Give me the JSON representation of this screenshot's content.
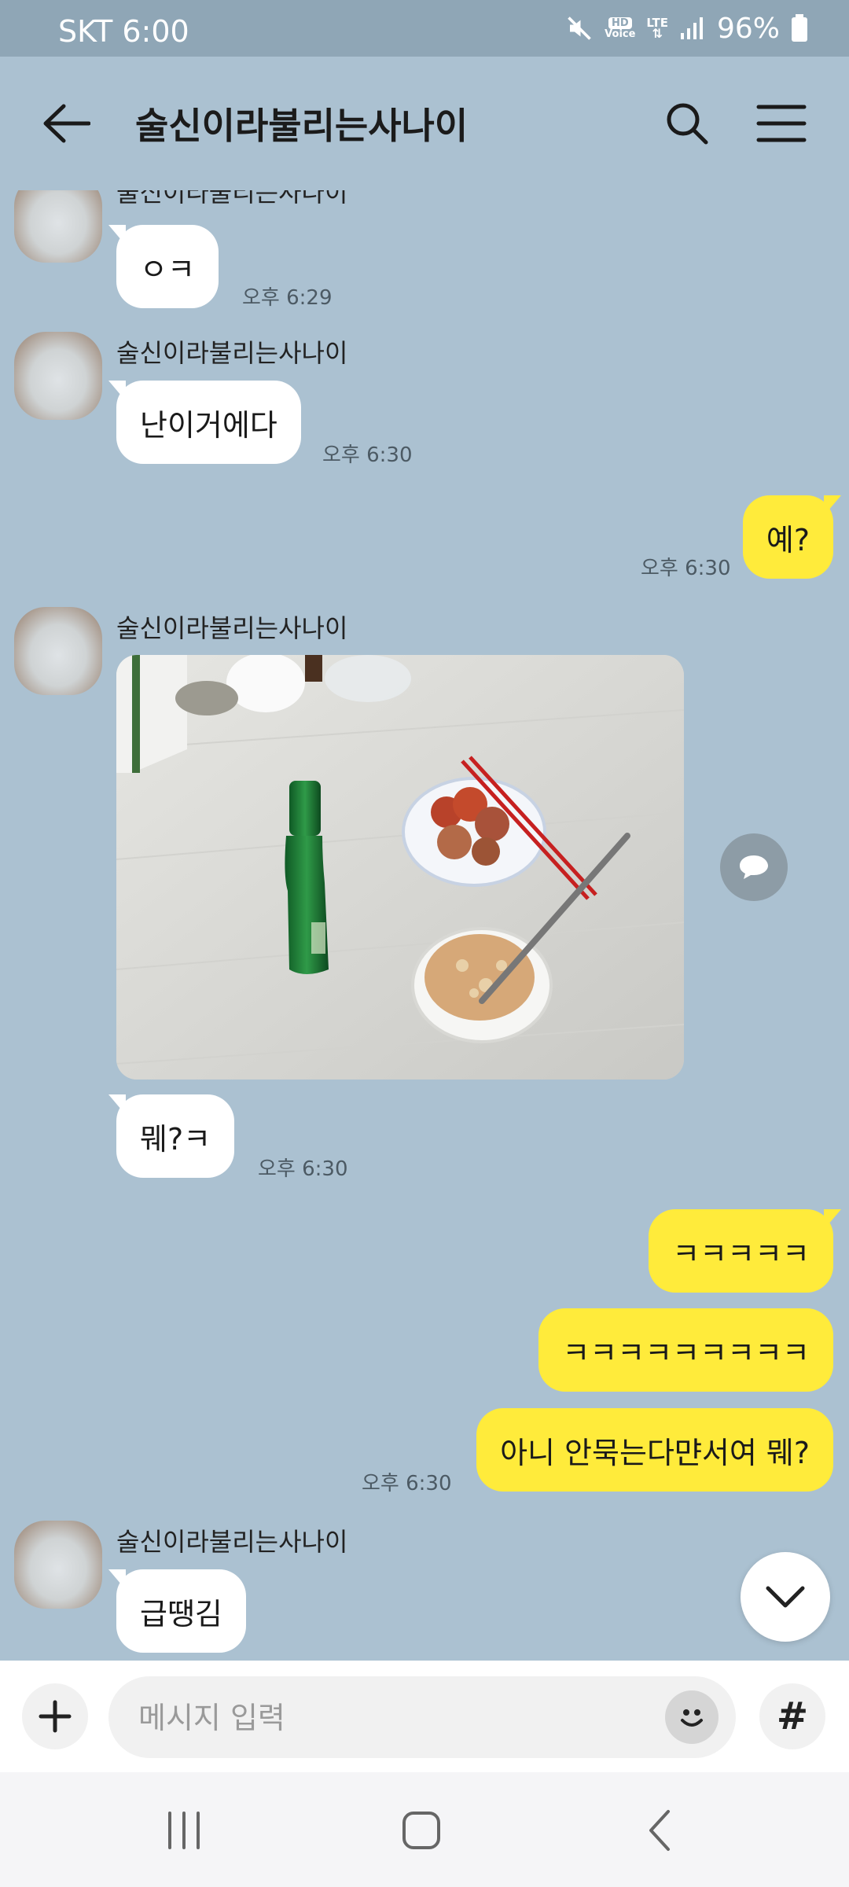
{
  "status_bar": {
    "carrier_time": "SKT 6:00",
    "hd_top": "HD",
    "hd_bottom": "Voice",
    "lte": "LTE",
    "battery": "96%"
  },
  "header": {
    "title": "술신이라불리는사나이",
    "back_icon": "arrow-left-icon",
    "search_icon": "search-icon",
    "menu_icon": "hamburger-icon"
  },
  "messages": [
    {
      "sender": "술신이라불리는사나이",
      "text": "ㅇㅋ",
      "time": "오후 6:29"
    },
    {
      "sender": "술신이라불리는사나이",
      "text": "난이거에다",
      "time": "오후 6:30"
    },
    {
      "text": "예?",
      "time": "오후 6:30"
    },
    {
      "sender": "술신이라불리는사나이",
      "time": ""
    },
    {
      "text": "뭬?ㅋ",
      "time": "오후 6:30"
    },
    {
      "text": "ㅋㅋㅋㅋㅋ"
    },
    {
      "text": "ㅋㅋㅋㅋㅋㅋㅋㅋㅋ"
    },
    {
      "text": "아니 안묵는다먄서여 뭬?",
      "time": "오후 6:30"
    },
    {
      "sender": "술신이라불리는사나이",
      "text": "급땡김"
    }
  ],
  "input": {
    "placeholder": "메시지 입력",
    "value": "",
    "hash": "#"
  },
  "colors": {
    "background": "#abc1d1",
    "my_bubble": "#ffeb3b",
    "their_bubble": "#ffffff",
    "status_bar": "#8fa6b6"
  }
}
